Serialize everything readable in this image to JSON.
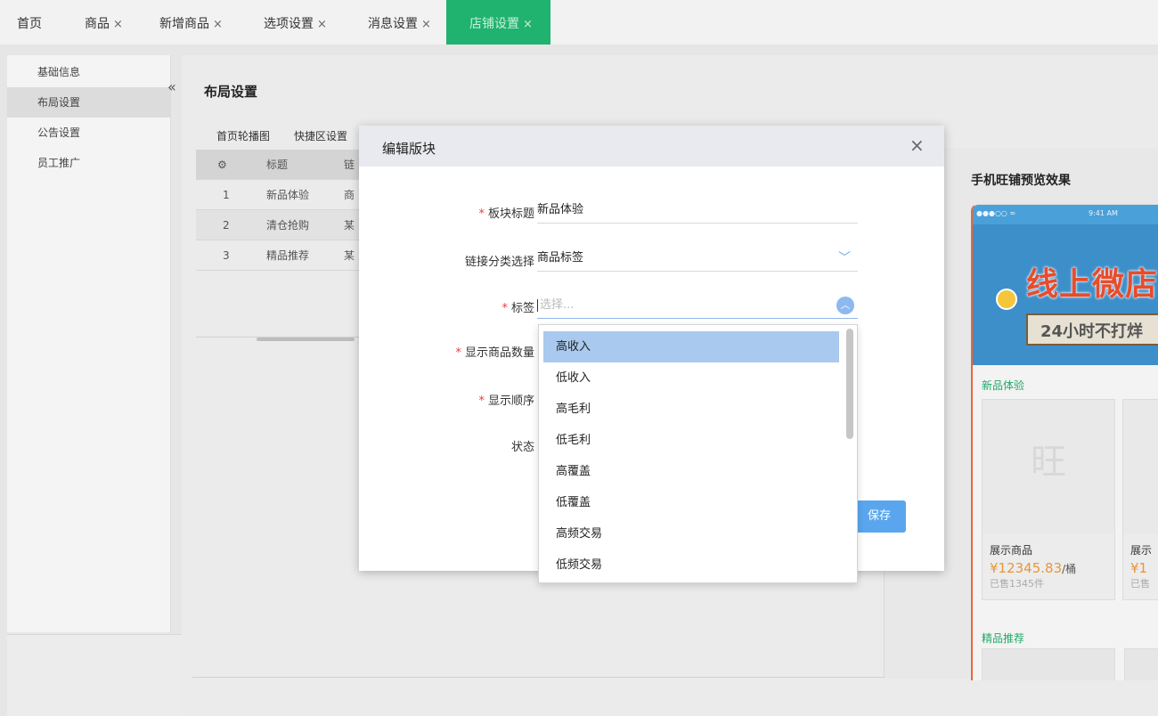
{
  "tabs": [
    {
      "label": "首页",
      "close": ""
    },
    {
      "label": "商品",
      "close": "×"
    },
    {
      "label": "新增商品",
      "close": "×"
    },
    {
      "label": "选项设置",
      "close": "×"
    },
    {
      "label": "消息设置",
      "close": "×"
    },
    {
      "label": "店铺设置",
      "close": "×"
    }
  ],
  "sidebar": {
    "collapse_icon": "«",
    "items": [
      "基础信息",
      "布局设置",
      "公告设置",
      "员工推广"
    ]
  },
  "page": {
    "title": "布局设置",
    "subtabs": [
      "首页轮播图",
      "快捷区设置"
    ],
    "table": {
      "headers": [
        "⚙",
        "标题",
        "链"
      ],
      "rows": [
        [
          "1",
          "新品体验",
          "商"
        ],
        [
          "2",
          "清仓抢购",
          "某"
        ],
        [
          "3",
          "精品推荐",
          "某"
        ]
      ]
    }
  },
  "preview": {
    "title": "手机旺铺预览效果",
    "status_left": "●●●○○ ≈",
    "status_time": "9:41 AM",
    "banner_big": "线上微店",
    "banner_small": "24小时不打烊",
    "section1": "新品体验",
    "section2": "精品推荐",
    "cards": [
      {
        "name": "展示商品",
        "price": "¥12345.83",
        "unit": "/桶",
        "sold": "已售1345件",
        "logo": "旺"
      },
      {
        "name": "展示",
        "price": "¥1",
        "unit": "",
        "sold": "已售",
        "logo": ""
      }
    ]
  },
  "modal": {
    "title": "编辑版块",
    "close": "×",
    "fields": {
      "block_title": {
        "label": "板块标题",
        "value": "新品体验",
        "required": true
      },
      "link_category": {
        "label": "链接分类选择",
        "value": "商品标签",
        "required": false
      },
      "tag": {
        "label": "标签",
        "placeholder": "选择...",
        "required": true
      },
      "show_count": {
        "label": "显示商品数量",
        "required": true
      },
      "show_order": {
        "label": "显示顺序",
        "required": true
      },
      "status": {
        "label": "状态",
        "required": false
      }
    },
    "required_mark": "*",
    "save_label": "保存"
  },
  "dropdown": {
    "options": [
      "高收入",
      "低收入",
      "高毛利",
      "低毛利",
      "高覆盖",
      "低覆盖",
      "高频交易",
      "低频交易"
    ],
    "hovered_index": 0
  },
  "colors": {
    "accent_green": "#20b26f",
    "primary_blue": "#5aa6ee",
    "required_red": "#e64242",
    "price_orange": "#e8973a"
  }
}
